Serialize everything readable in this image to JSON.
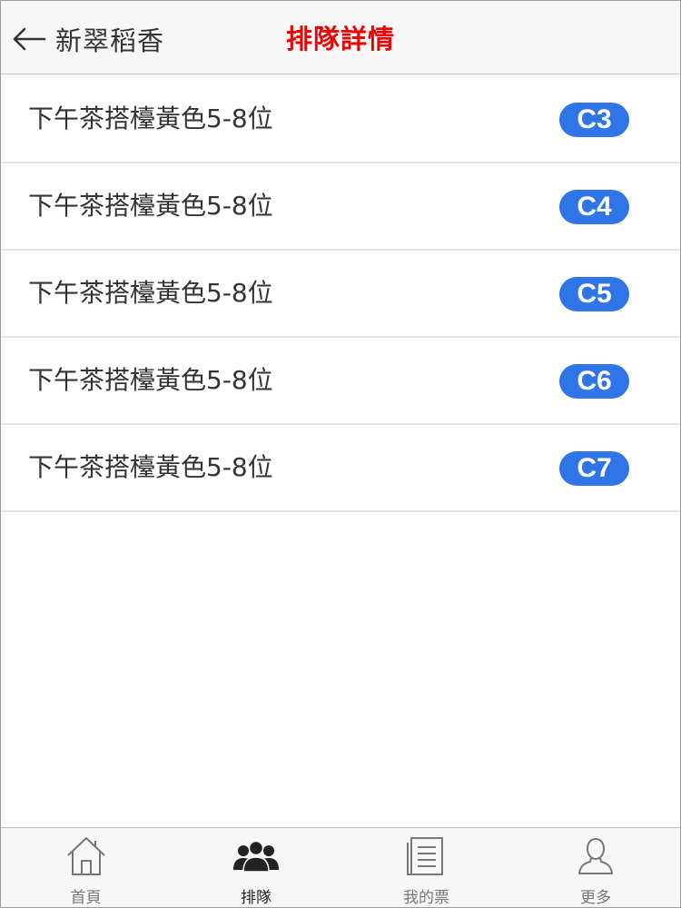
{
  "header": {
    "back_label": "新翠稻香",
    "title": "排隊詳情",
    "title_color": "#f00000"
  },
  "queues": [
    {
      "label": "下午茶搭檯黃色5-8位",
      "code": "C3"
    },
    {
      "label": "下午茶搭檯黃色5-8位",
      "code": "C4"
    },
    {
      "label": "下午茶搭檯黃色5-8位",
      "code": "C5"
    },
    {
      "label": "下午茶搭檯黃色5-8位",
      "code": "C6"
    },
    {
      "label": "下午茶搭檯黃色5-8位",
      "code": "C7"
    }
  ],
  "badge_color": "#2f75e8",
  "tabbar": {
    "items": [
      {
        "label": "首頁",
        "icon": "home-icon",
        "active": false
      },
      {
        "label": "排隊",
        "icon": "people-group-icon",
        "active": true
      },
      {
        "label": "我的票",
        "icon": "ticket-list-icon",
        "active": false
      },
      {
        "label": "更多",
        "icon": "person-outline-icon",
        "active": false
      }
    ]
  }
}
